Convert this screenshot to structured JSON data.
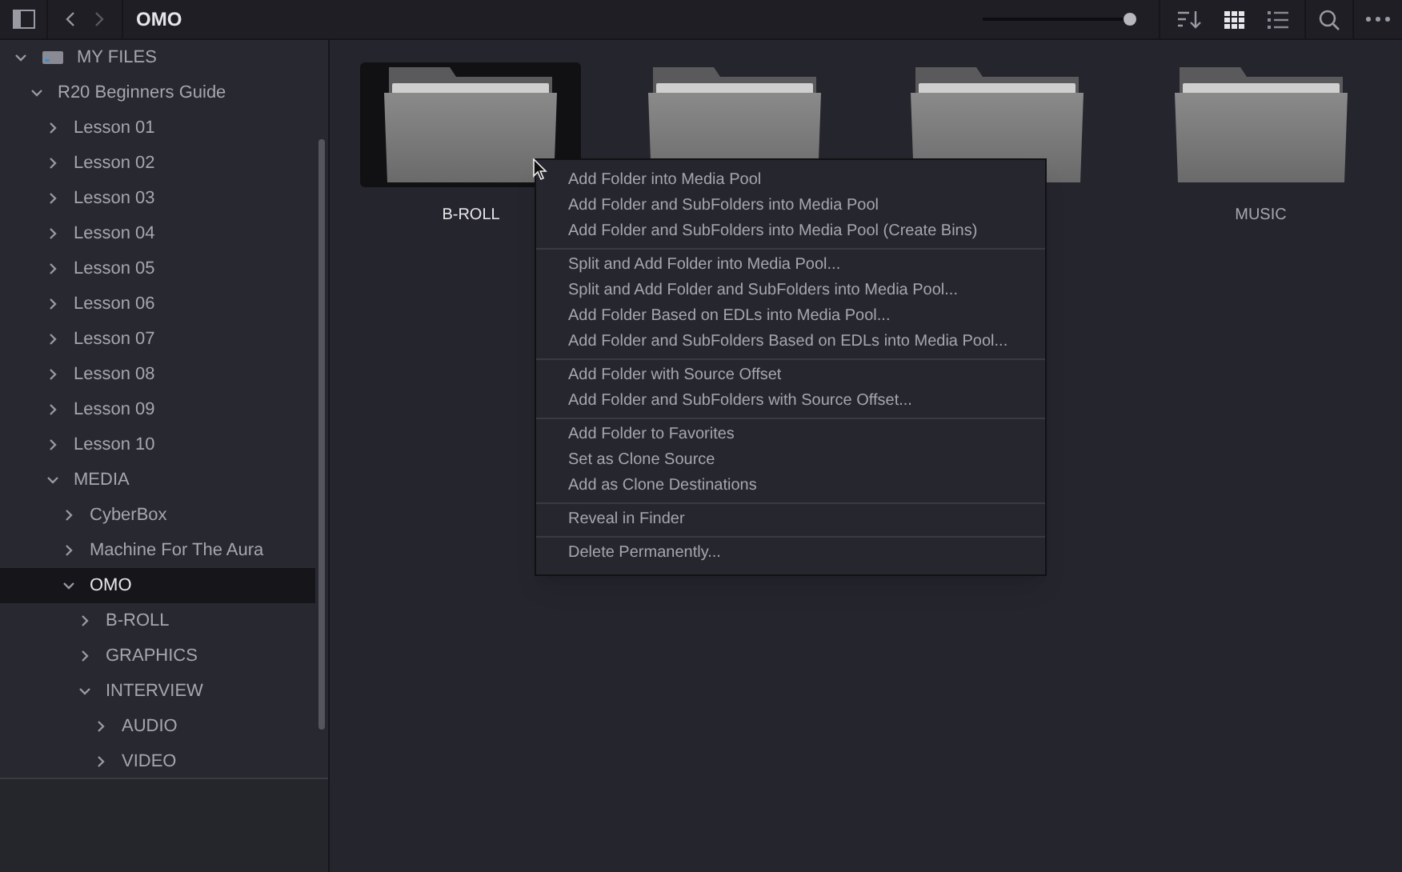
{
  "toolbar": {
    "title": "OMO",
    "zoom_slider": {
      "level": 1.0
    },
    "view_modes": [
      {
        "kind": "grid",
        "selected": true
      },
      {
        "kind": "list",
        "selected": false
      }
    ]
  },
  "sidebar": {
    "tree": [
      {
        "label": "MY FILES",
        "kind": "drive",
        "expanded": true,
        "selected": false,
        "children": [
          {
            "label": "R20 Beginners Guide",
            "expanded": true,
            "selected": false,
            "children": [
              {
                "label": "Lesson 01",
                "expanded": false,
                "selected": false
              },
              {
                "label": "Lesson 02",
                "expanded": false,
                "selected": false
              },
              {
                "label": "Lesson 03",
                "expanded": false,
                "selected": false
              },
              {
                "label": "Lesson 04",
                "expanded": false,
                "selected": false
              },
              {
                "label": "Lesson 05",
                "expanded": false,
                "selected": false
              },
              {
                "label": "Lesson 06",
                "expanded": false,
                "selected": false
              },
              {
                "label": "Lesson 07",
                "expanded": false,
                "selected": false
              },
              {
                "label": "Lesson 08",
                "expanded": false,
                "selected": false
              },
              {
                "label": "Lesson 09",
                "expanded": false,
                "selected": false
              },
              {
                "label": "Lesson 10",
                "expanded": false,
                "selected": false
              },
              {
                "label": "MEDIA",
                "expanded": true,
                "selected": false,
                "children": [
                  {
                    "label": "CyberBox",
                    "expanded": false,
                    "selected": false
                  },
                  {
                    "label": "Machine For The Aura",
                    "expanded": false,
                    "selected": false
                  },
                  {
                    "label": "OMO",
                    "expanded": true,
                    "selected": true,
                    "children": [
                      {
                        "label": "B-ROLL",
                        "expanded": false,
                        "selected": false
                      },
                      {
                        "label": "GRAPHICS",
                        "expanded": false,
                        "selected": false
                      },
                      {
                        "label": "INTERVIEW",
                        "expanded": true,
                        "selected": false,
                        "children": [
                          {
                            "label": "AUDIO",
                            "expanded": false,
                            "selected": false
                          },
                          {
                            "label": "VIDEO",
                            "expanded": false,
                            "selected": false
                          }
                        ]
                      }
                    ]
                  }
                ]
              }
            ]
          }
        ]
      }
    ]
  },
  "folders": [
    {
      "label": "B-ROLL",
      "selected": true
    },
    {
      "selected": false
    },
    {
      "selected": false
    },
    {
      "label": "MUSIC",
      "selected": false
    }
  ],
  "context_menu": [
    [
      "Add Folder into Media Pool",
      "Add Folder and SubFolders into Media Pool",
      "Add Folder and SubFolders into Media Pool (Create Bins)"
    ],
    [
      "Split and Add Folder into Media Pool...",
      "Split and Add Folder and SubFolders into Media Pool...",
      "Add Folder Based on EDLs into Media Pool...",
      "Add Folder and SubFolders Based on EDLs into Media Pool..."
    ],
    [
      "Add Folder with Source Offset",
      "Add Folder and SubFolders with Source Offset..."
    ],
    [
      "Add Folder to Favorites",
      "Set as Clone Source",
      "Add as Clone Destinations"
    ],
    [
      "Reveal in Finder"
    ],
    [
      "Delete Permanently..."
    ]
  ]
}
